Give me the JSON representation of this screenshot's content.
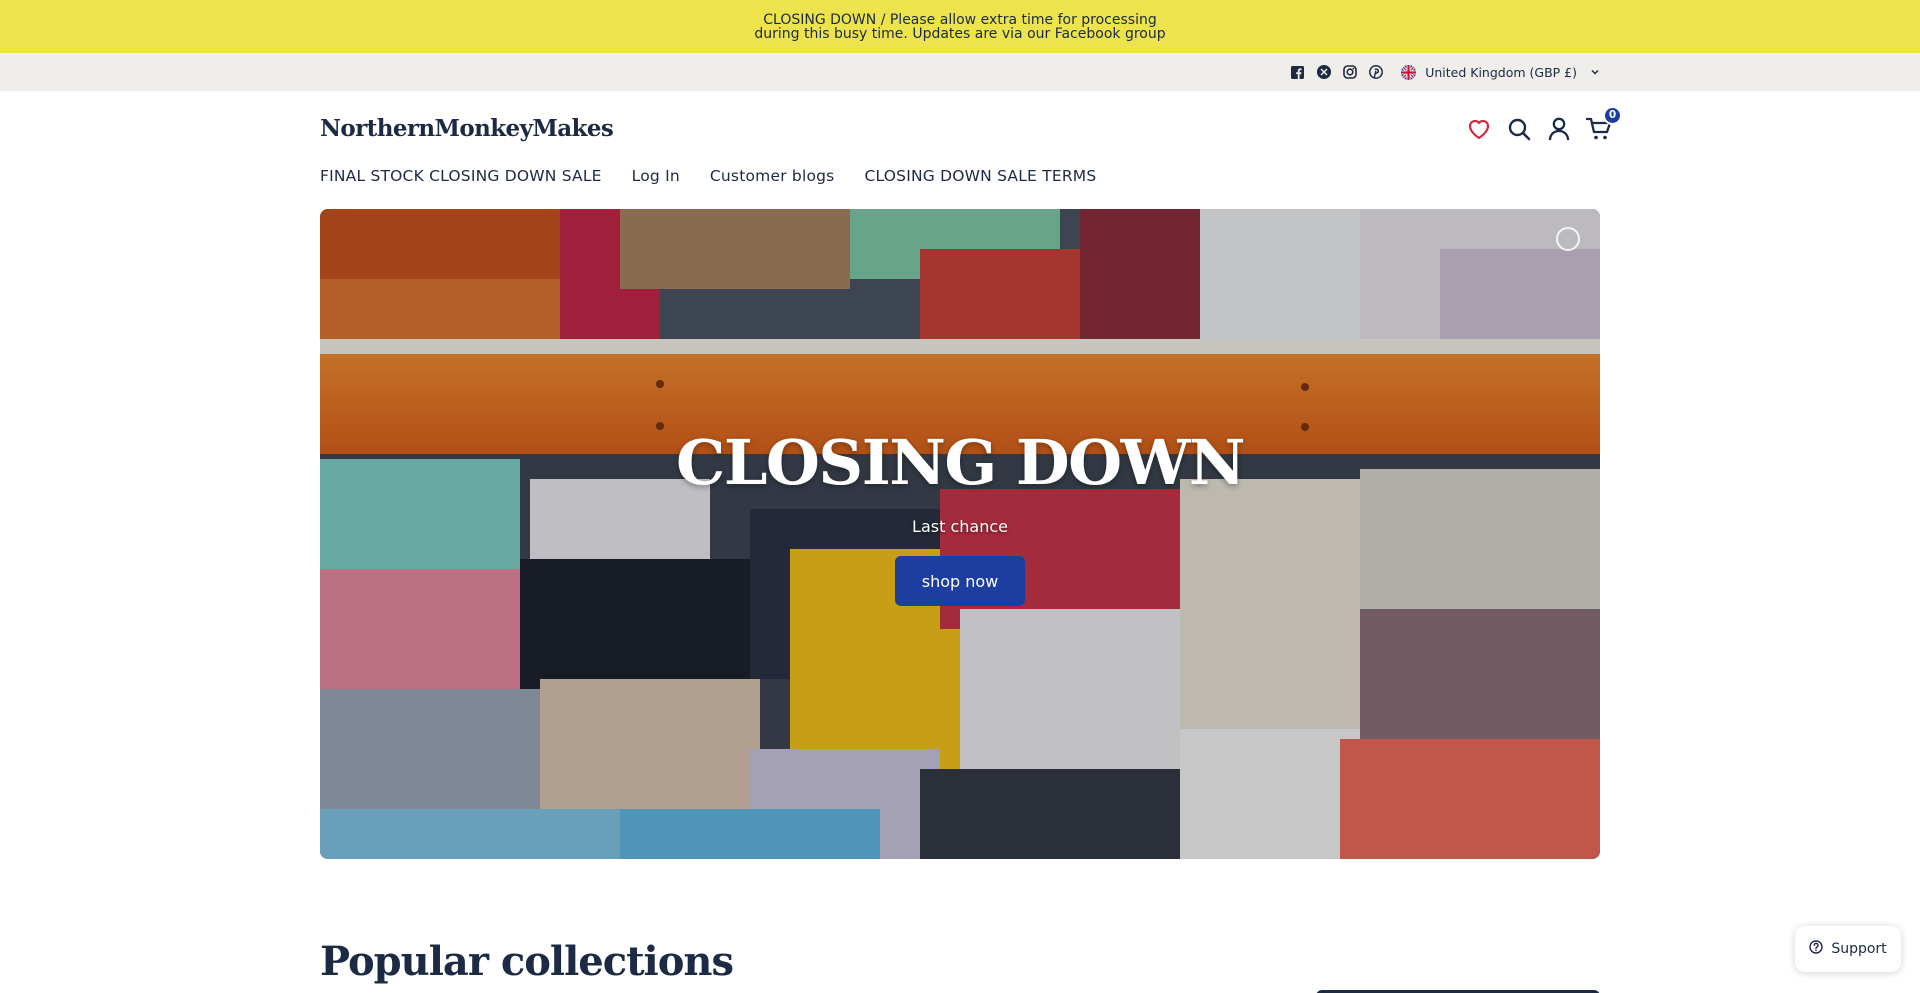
{
  "announcement": {
    "text": "CLOSING DOWN / Please allow extra time for processing during this busy time. Updates are via our Facebook group"
  },
  "utility": {
    "social_icons": [
      "facebook-icon",
      "x-icon",
      "instagram-icon",
      "pinterest-icon"
    ],
    "locale_label": "United Kingdom (GBP £)"
  },
  "header": {
    "logo": "NorthernMonkeyMakes",
    "cart_count": "0"
  },
  "nav": {
    "items": [
      {
        "label": "FINAL STOCK CLOSING DOWN SALE"
      },
      {
        "label": "Log In"
      },
      {
        "label": "Customer blogs"
      },
      {
        "label": "CLOSING DOWN SALE TERMS"
      }
    ]
  },
  "hero": {
    "title": "CLOSING DOWN",
    "subtitle": "Last chance",
    "button_label": "shop now"
  },
  "sections": {
    "popular_title": "Popular collections"
  },
  "support": {
    "label": "Support"
  },
  "colors": {
    "announcement_bg": "#ede44d",
    "utility_bg": "#f0eeea",
    "brand_navy": "#1c2a44",
    "accent_blue": "#1c3ea0",
    "wishlist_red": "#d6263b"
  }
}
